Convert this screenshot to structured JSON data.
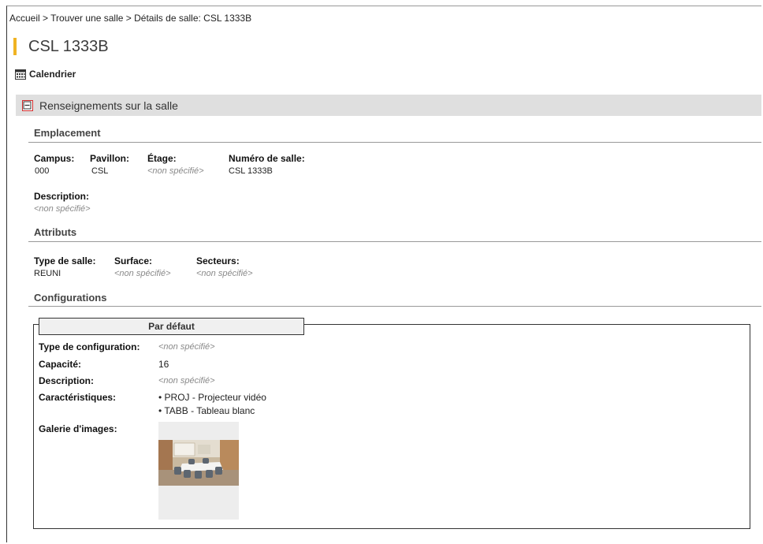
{
  "breadcrumb": {
    "home": "Accueil",
    "sep1": " > ",
    "find": "Trouver une salle",
    "sep2": " > ",
    "current": "Détails de salle: CSL 1333B"
  },
  "page_title": "CSL 1333B",
  "calendar_link": "Calendrier",
  "section": {
    "title": "Renseignements sur la salle"
  },
  "emplacement": {
    "heading": "Emplacement",
    "campus_label": "Campus:",
    "campus_value": "000",
    "pavillon_label": "Pavillon:",
    "pavillon_value": "CSL",
    "etage_label": "Étage:",
    "etage_value": "<non spécifié>",
    "numero_label": "Numéro de salle:",
    "numero_value": "CSL 1333B",
    "description_label": "Description:",
    "description_value": "<non spécifié>"
  },
  "attributs": {
    "heading": "Attributs",
    "type_label": "Type de salle:",
    "type_value": "REUNI",
    "surface_label": "Surface:",
    "surface_value": "<non spécifié>",
    "secteurs_label": "Secteurs:",
    "secteurs_value": "<non spécifié>"
  },
  "configurations": {
    "heading": "Configurations",
    "tab_label": "Par défaut",
    "type_config_label": "Type de configuration:",
    "type_config_value": "<non spécifié>",
    "capacite_label": "Capacité:",
    "capacite_value": "16",
    "description_label": "Description:",
    "description_value": "<non spécifié>",
    "caracteristiques_label": "Caractéristiques:",
    "caracteristiques": [
      "• PROJ - Projecteur vidéo",
      "• TABB - Tableau blanc"
    ],
    "galerie_label": "Galerie d'images:"
  },
  "colors": {
    "title_accent": "#f0b323",
    "collapse_border": "#d32f2f",
    "section_bg": "#dfdfdf",
    "not_specified": "#8a8a8a"
  },
  "icons": {
    "calendar": "calendar-icon",
    "collapse": "collapse-minus-icon"
  }
}
